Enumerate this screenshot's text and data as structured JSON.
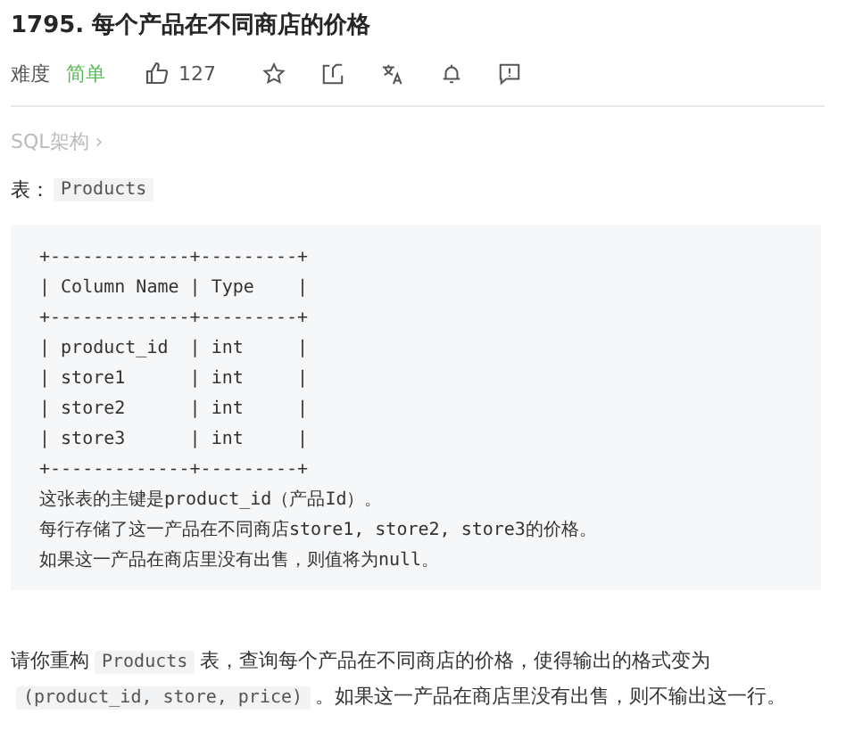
{
  "title": "1795. 每个产品在不同商店的价格",
  "meta": {
    "difficulty_label": "难度",
    "difficulty": "简单",
    "likes": "127"
  },
  "breadcrumb": "SQL架构 ›",
  "table_label": {
    "prefix": "表：",
    "code": "Products"
  },
  "schema_lines": [
    "+-------------+---------+",
    "| Column Name | Type    |",
    "+-------------+---------+",
    "| product_id  | int     |",
    "| store1      | int     |",
    "| store2      | int     |",
    "| store3      | int     |",
    "+-------------+---------+",
    "这张表的主键是product_id（产品Id）。",
    "每行存储了这一产品在不同商店store1, store2, store3的价格。",
    "如果这一产品在商店里没有出售，则值将为null。"
  ],
  "question": [
    {
      "kind": "text",
      "text": "请你重构"
    },
    {
      "kind": "code",
      "text": "Products"
    },
    {
      "kind": "text",
      "text": "表，查询每个产品在不同商店的价格，使得输出的格式变为"
    },
    {
      "kind": "code",
      "text": "(product_id, store, price)"
    },
    {
      "kind": "text",
      "text": "。如果这一产品在商店里没有出售，则不输出这一行。"
    }
  ]
}
